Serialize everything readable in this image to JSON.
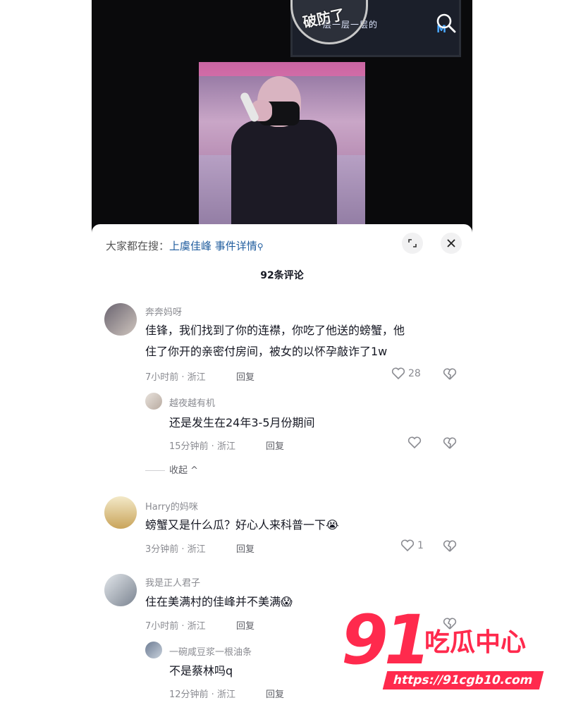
{
  "video": {
    "lyric": "一层一层一层的",
    "screen_brand": "M",
    "sticker": "破防了",
    "search_icon": "search-icon"
  },
  "search_bar": {
    "prefix": "大家都在搜：",
    "keyword": "上虞佳峰 事件详情",
    "keyword_icon": "search-icon"
  },
  "comment_count": "92条评论",
  "comments": [
    {
      "user": "奔奔妈呀",
      "text_line1": "佳锋，我们找到了你的连襟，你吃了他送的螃蟹，他",
      "text_line2": "住了你开的亲密付房间，被女的以怀孕敲诈了1w",
      "meta": "7小时前 · 浙江",
      "reply_label": "回复",
      "likes": "28",
      "replies": [
        {
          "user": "越夜越有机",
          "text": "还是发生在24年3-5月份期间",
          "meta": "15分钟前 · 浙江",
          "reply_label": "回复",
          "likes": ""
        }
      ],
      "collapse_label": "收起"
    },
    {
      "user": "Harry的妈咪",
      "text": "螃蟹又是什么瓜？好心人来科普一下😭",
      "meta": "3分钟前 · 浙江",
      "reply_label": "回复",
      "likes": "1"
    },
    {
      "user": "我是正人君子",
      "text": "住在美满村的佳峰并不美满😱",
      "meta": "7小时前 · 浙江",
      "reply_label": "回复",
      "likes": "",
      "replies": [
        {
          "user": "一碗咸豆浆一根油条",
          "text": "不是蔡林吗q",
          "meta": "12分钟前 · 浙江",
          "reply_label": "回复"
        }
      ]
    }
  ],
  "watermark": {
    "number": "91",
    "text": "吃瓜中心",
    "url": "https://91cgb10.com"
  },
  "colors": {
    "keyword": "#1f5c9e",
    "watermark": "#ff2a4d",
    "meta": "#8a8b91"
  }
}
